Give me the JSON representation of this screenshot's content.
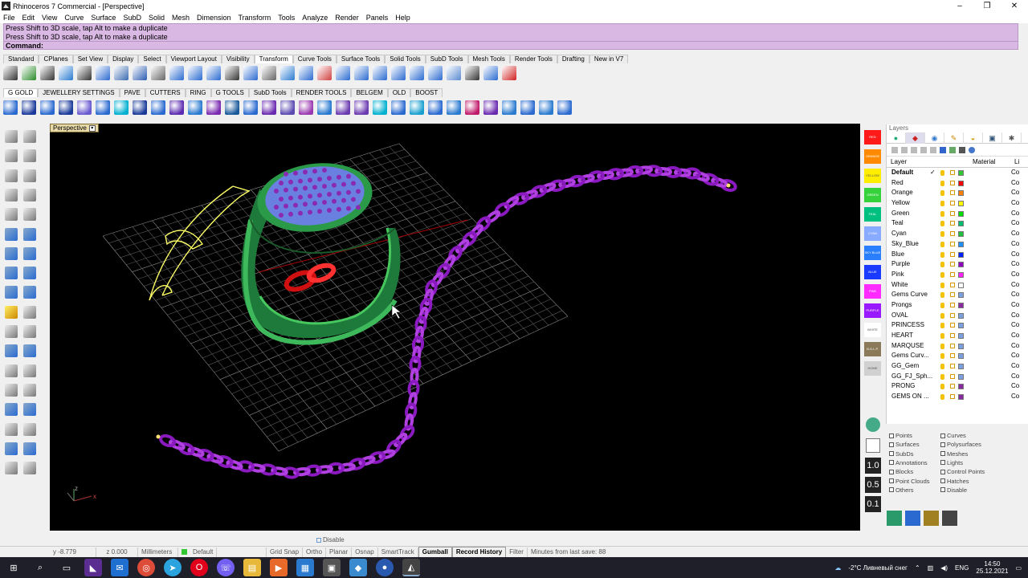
{
  "window": {
    "title": "Rhinoceros 7 Commercial - [Perspective]",
    "controls": [
      "–",
      "❐",
      "✕"
    ]
  },
  "menu": [
    "File",
    "Edit",
    "View",
    "Curve",
    "Surface",
    "SubD",
    "Solid",
    "Mesh",
    "Dimension",
    "Transform",
    "Tools",
    "Analyze",
    "Render",
    "Panels",
    "Help"
  ],
  "command": {
    "history": [
      "Press Shift to 3D scale, tap Alt to make a duplicate",
      "Press Shift to 3D scale, tap Alt to make a duplicate"
    ],
    "prompt": "Command:"
  },
  "toolbar_tabs": [
    "Standard",
    "CPlanes",
    "Set View",
    "Display",
    "Select",
    "Viewport Layout",
    "Visibility",
    "Transform",
    "Curve Tools",
    "Surface Tools",
    "Solid Tools",
    "SubD Tools",
    "Mesh Tools",
    "Render Tools",
    "Drafting",
    "New in V7"
  ],
  "active_toolbar_tab": "Transform",
  "plugin_tabs": [
    "G GOLD",
    "JEWELLERY SETTINGS",
    "PAVE",
    "CUTTERS",
    "RING",
    "G TOOLS",
    "SubD Tools",
    "RENDER TOOLS",
    "BELGEM",
    "OLD",
    "BOOST"
  ],
  "viewport": {
    "name": "Perspective",
    "axis_z": "z",
    "axis_x": "x"
  },
  "color_buttons": [
    {
      "label": "RED",
      "color": "#ff1a1a"
    },
    {
      "label": "ORANGE",
      "color": "#ff8a00"
    },
    {
      "label": "YELLOW",
      "color": "#ffee00"
    },
    {
      "label": "GREEN",
      "color": "#35d23b"
    },
    {
      "label": "TEAL",
      "color": "#00c080"
    },
    {
      "label": "CYAN",
      "color": "#88aaff"
    },
    {
      "label": "SKY BLUE",
      "color": "#2a7fff"
    },
    {
      "label": "BLUE",
      "color": "#1a3aff"
    },
    {
      "label": "PINK",
      "color": "#ff2aff"
    },
    {
      "label": "PURPLE",
      "color": "#9a1aff"
    },
    {
      "label": "WHITE",
      "color": "#ffffff"
    },
    {
      "label": "B.G.L.P.",
      "color": "#8a7a5a"
    },
    {
      "label": "HOME",
      "color": "#d0d0d0"
    }
  ],
  "layers": {
    "title": "Layers",
    "col_layer": "Layer",
    "col_material": "Material",
    "col_li": "Li",
    "rows": [
      {
        "name": "Default",
        "color": "#32c832",
        "co": "Co",
        "current": true
      },
      {
        "name": "Red",
        "color": "#ff0000",
        "co": "Co"
      },
      {
        "name": "Orange",
        "color": "#ff8000",
        "co": "Co"
      },
      {
        "name": "Yellow",
        "color": "#ffff00",
        "co": "Co"
      },
      {
        "name": "Green",
        "color": "#00e000",
        "co": "Co"
      },
      {
        "name": "Teal",
        "color": "#00c070",
        "co": "Co"
      },
      {
        "name": "Cyan",
        "color": "#20c040",
        "co": "Co"
      },
      {
        "name": "Sky_Blue",
        "color": "#2090ff",
        "co": "Co"
      },
      {
        "name": "Blue",
        "color": "#0020ff",
        "co": "Co"
      },
      {
        "name": "Purple",
        "color": "#9000c0",
        "co": "Co"
      },
      {
        "name": "Pink",
        "color": "#ff20ff",
        "co": "Co"
      },
      {
        "name": "White",
        "color": "#ffffff",
        "co": "Co"
      },
      {
        "name": "Gems Curve",
        "color": "#7aa0e0",
        "co": "Co"
      },
      {
        "name": "Prongs",
        "color": "#8a2aa0",
        "co": "Co"
      },
      {
        "name": "OVAL",
        "color": "#7aa0e0",
        "co": "Co"
      },
      {
        "name": "PRINCESS",
        "color": "#7aa0e0",
        "co": "Co"
      },
      {
        "name": "HEART",
        "color": "#7aa0e0",
        "co": "Co"
      },
      {
        "name": "MARQUSE",
        "color": "#7aa0e0",
        "co": "Co"
      },
      {
        "name": "Gems Curv...",
        "color": "#7aa0e0",
        "co": "Co"
      },
      {
        "name": "GG_Gem",
        "color": "#7aa0e0",
        "co": "Co"
      },
      {
        "name": "GG_FJ_Sph...",
        "color": "#7aa0e0",
        "co": "Co"
      },
      {
        "name": "PRONG",
        "color": "#8a2aa0",
        "co": "Co"
      },
      {
        "name": "GEMS ON ...",
        "color": "#8a2aa0",
        "co": "Co"
      }
    ]
  },
  "display_filters": [
    [
      "Points",
      "Curves"
    ],
    [
      "Surfaces",
      "Polysurfaces"
    ],
    [
      "SubDs",
      "Meshes"
    ],
    [
      "Annotations",
      "Lights"
    ],
    [
      "Blocks",
      "Control Points"
    ],
    [
      "Point Clouds",
      "Hatches"
    ],
    [
      "Others",
      "Disable"
    ]
  ],
  "scale_buttons": [
    "1.0",
    "0.5",
    "0.1"
  ],
  "osnap_disable": "Disable",
  "status": {
    "coord": "y -8.779",
    "z": "z 0.000",
    "units": "Millimeters",
    "layer": "Default",
    "items": [
      "Grid Snap",
      "Ortho",
      "Planar",
      "Osnap",
      "SmartTrack"
    ],
    "gumball": "Gumball",
    "record_history": "Record History",
    "filter": "Filter",
    "autosave": "Minutes from last save: 88"
  },
  "taskbar": {
    "weather": "-2°C  Ливневый снег",
    "lang": "ENG",
    "time": "14:50",
    "date": "25.12.2021"
  }
}
